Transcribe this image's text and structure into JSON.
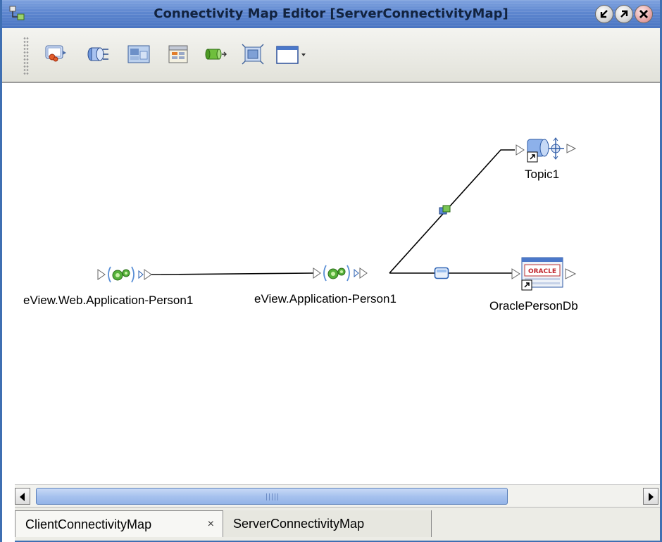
{
  "window": {
    "title": "Connectivity Map Editor [ServerConnectivityMap]",
    "accent_color": "#4a75c2"
  },
  "toolbar": {
    "tools": [
      {
        "icon": "collaboration-icon"
      },
      {
        "icon": "external-application-icon"
      },
      {
        "icon": "web-connector-icon"
      },
      {
        "icon": "calendar-scheduler-icon"
      },
      {
        "icon": "queue-icon"
      },
      {
        "icon": "service-icon"
      },
      {
        "icon": "layout-dropdown-icon"
      }
    ]
  },
  "canvas": {
    "nodes": [
      {
        "name": "eView.Web.Application-Person1",
        "type": "project"
      },
      {
        "name": "eView.Application-Person1",
        "type": "project"
      },
      {
        "name": "Topic1",
        "type": "topic"
      },
      {
        "name": "OraclePersonDb",
        "type": "oracle-external"
      }
    ],
    "oracle_badge": "ORACLE"
  },
  "tabs": [
    {
      "label": "ClientConnectivityMap",
      "close": "×",
      "active": true
    },
    {
      "label": "ServerConnectivityMap",
      "active": false
    }
  ]
}
